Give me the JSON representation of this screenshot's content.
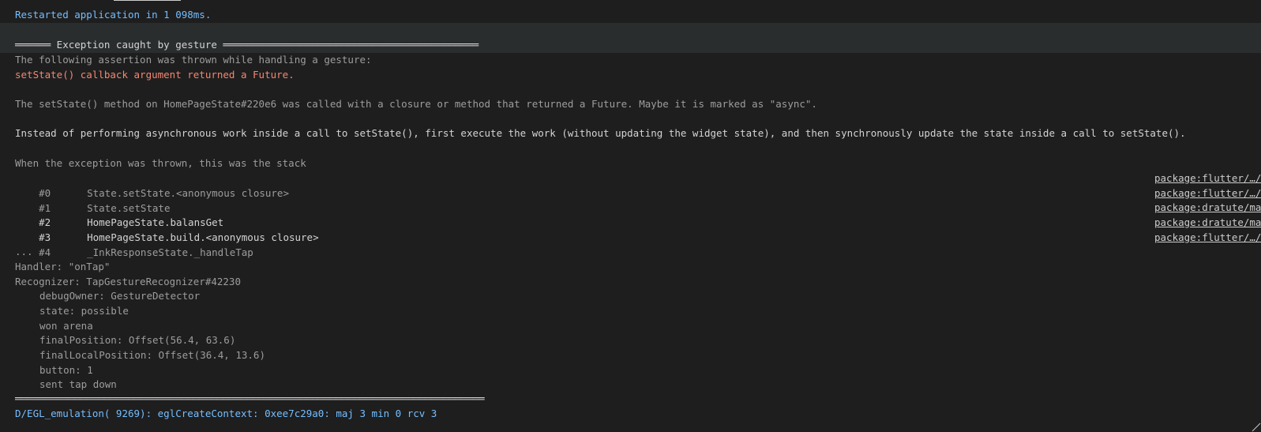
{
  "console": {
    "restart_line": "Restarted application in 1 098ms.",
    "exception_header": "══════ Exception caught by gesture ═══════════════════════════════════════════",
    "assertion_intro": "The following assertion was thrown while handling a gesture:",
    "error_message": "setState() callback argument returned a Future.",
    "explanation": "The setState() method on HomePageState#220e6 was called with a closure or method that returned a Future. Maybe it is marked as \"async\".",
    "advice": "Instead of performing asynchronous work inside a call to setState(), first execute the work (without updating the widget state), and then synchronously update the state inside a call to setState().",
    "stack_intro": "When the exception was thrown, this was the stack",
    "stack_frames": [
      {
        "num": "#0",
        "method": "State.setState.<anonymous closure>",
        "link": "package:flutter/…/"
      },
      {
        "num": "#1",
        "method": "State.setState",
        "link": "package:flutter/…/"
      },
      {
        "num": "#2",
        "method": "HomePageState.balansGet",
        "link": "package:dratute/ma"
      },
      {
        "num": "#3",
        "method": "HomePageState.build.<anonymous closure>",
        "link": "package:dratute/ma"
      },
      {
        "num": "#4",
        "method": "_InkResponseState._handleTap",
        "link": "package:flutter/…/"
      }
    ],
    "ellipsis": "...",
    "handler": "Handler: \"onTap\"",
    "recognizer": "Recognizer: TapGestureRecognizer#42230",
    "recognizer_details": [
      "debugOwner: GestureDetector",
      "state: possible",
      "won arena",
      "finalPosition: Offset(56.4, 63.6)",
      "finalLocalPosition: Offset(36.4, 13.6)",
      "button: 1",
      "sent tap down"
    ],
    "footer_rule": "═══════════════════════════════════════════════════════════════════════════════",
    "egl_line": "D/EGL_emulation( 9269): eglCreateContext: 0xee7c29a0: maj 3 min 0 rcv 3"
  },
  "colors": {
    "background": "#1e1e1e",
    "info_blue": "#75beff",
    "error_red": "#f48771",
    "text": "#cccccc",
    "highlight_row": "#2a2d2e"
  }
}
